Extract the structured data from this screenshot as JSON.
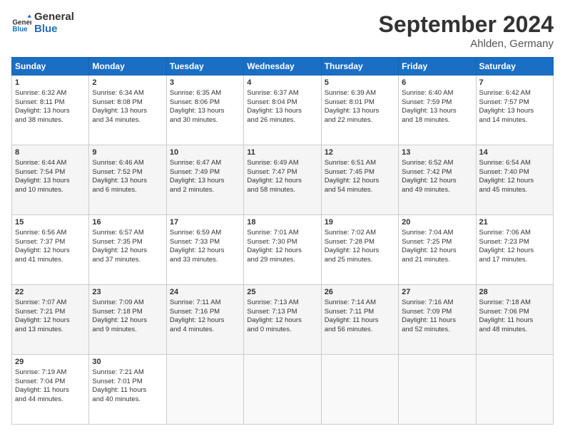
{
  "header": {
    "logo_line1": "General",
    "logo_line2": "Blue",
    "month": "September 2024",
    "location": "Ahlden, Germany"
  },
  "weekdays": [
    "Sunday",
    "Monday",
    "Tuesday",
    "Wednesday",
    "Thursday",
    "Friday",
    "Saturday"
  ],
  "weeks": [
    [
      {
        "day": "1",
        "lines": [
          "Sunrise: 6:32 AM",
          "Sunset: 8:11 PM",
          "Daylight: 13 hours",
          "and 38 minutes."
        ]
      },
      {
        "day": "2",
        "lines": [
          "Sunrise: 6:34 AM",
          "Sunset: 8:08 PM",
          "Daylight: 13 hours",
          "and 34 minutes."
        ]
      },
      {
        "day": "3",
        "lines": [
          "Sunrise: 6:35 AM",
          "Sunset: 8:06 PM",
          "Daylight: 13 hours",
          "and 30 minutes."
        ]
      },
      {
        "day": "4",
        "lines": [
          "Sunrise: 6:37 AM",
          "Sunset: 8:04 PM",
          "Daylight: 13 hours",
          "and 26 minutes."
        ]
      },
      {
        "day": "5",
        "lines": [
          "Sunrise: 6:39 AM",
          "Sunset: 8:01 PM",
          "Daylight: 13 hours",
          "and 22 minutes."
        ]
      },
      {
        "day": "6",
        "lines": [
          "Sunrise: 6:40 AM",
          "Sunset: 7:59 PM",
          "Daylight: 13 hours",
          "and 18 minutes."
        ]
      },
      {
        "day": "7",
        "lines": [
          "Sunrise: 6:42 AM",
          "Sunset: 7:57 PM",
          "Daylight: 13 hours",
          "and 14 minutes."
        ]
      }
    ],
    [
      {
        "day": "8",
        "lines": [
          "Sunrise: 6:44 AM",
          "Sunset: 7:54 PM",
          "Daylight: 13 hours",
          "and 10 minutes."
        ]
      },
      {
        "day": "9",
        "lines": [
          "Sunrise: 6:46 AM",
          "Sunset: 7:52 PM",
          "Daylight: 13 hours",
          "and 6 minutes."
        ]
      },
      {
        "day": "10",
        "lines": [
          "Sunrise: 6:47 AM",
          "Sunset: 7:49 PM",
          "Daylight: 13 hours",
          "and 2 minutes."
        ]
      },
      {
        "day": "11",
        "lines": [
          "Sunrise: 6:49 AM",
          "Sunset: 7:47 PM",
          "Daylight: 12 hours",
          "and 58 minutes."
        ]
      },
      {
        "day": "12",
        "lines": [
          "Sunrise: 6:51 AM",
          "Sunset: 7:45 PM",
          "Daylight: 12 hours",
          "and 54 minutes."
        ]
      },
      {
        "day": "13",
        "lines": [
          "Sunrise: 6:52 AM",
          "Sunset: 7:42 PM",
          "Daylight: 12 hours",
          "and 49 minutes."
        ]
      },
      {
        "day": "14",
        "lines": [
          "Sunrise: 6:54 AM",
          "Sunset: 7:40 PM",
          "Daylight: 12 hours",
          "and 45 minutes."
        ]
      }
    ],
    [
      {
        "day": "15",
        "lines": [
          "Sunrise: 6:56 AM",
          "Sunset: 7:37 PM",
          "Daylight: 12 hours",
          "and 41 minutes."
        ]
      },
      {
        "day": "16",
        "lines": [
          "Sunrise: 6:57 AM",
          "Sunset: 7:35 PM",
          "Daylight: 12 hours",
          "and 37 minutes."
        ]
      },
      {
        "day": "17",
        "lines": [
          "Sunrise: 6:59 AM",
          "Sunset: 7:33 PM",
          "Daylight: 12 hours",
          "and 33 minutes."
        ]
      },
      {
        "day": "18",
        "lines": [
          "Sunrise: 7:01 AM",
          "Sunset: 7:30 PM",
          "Daylight: 12 hours",
          "and 29 minutes."
        ]
      },
      {
        "day": "19",
        "lines": [
          "Sunrise: 7:02 AM",
          "Sunset: 7:28 PM",
          "Daylight: 12 hours",
          "and 25 minutes."
        ]
      },
      {
        "day": "20",
        "lines": [
          "Sunrise: 7:04 AM",
          "Sunset: 7:25 PM",
          "Daylight: 12 hours",
          "and 21 minutes."
        ]
      },
      {
        "day": "21",
        "lines": [
          "Sunrise: 7:06 AM",
          "Sunset: 7:23 PM",
          "Daylight: 12 hours",
          "and 17 minutes."
        ]
      }
    ],
    [
      {
        "day": "22",
        "lines": [
          "Sunrise: 7:07 AM",
          "Sunset: 7:21 PM",
          "Daylight: 12 hours",
          "and 13 minutes."
        ]
      },
      {
        "day": "23",
        "lines": [
          "Sunrise: 7:09 AM",
          "Sunset: 7:18 PM",
          "Daylight: 12 hours",
          "and 9 minutes."
        ]
      },
      {
        "day": "24",
        "lines": [
          "Sunrise: 7:11 AM",
          "Sunset: 7:16 PM",
          "Daylight: 12 hours",
          "and 4 minutes."
        ]
      },
      {
        "day": "25",
        "lines": [
          "Sunrise: 7:13 AM",
          "Sunset: 7:13 PM",
          "Daylight: 12 hours",
          "and 0 minutes."
        ]
      },
      {
        "day": "26",
        "lines": [
          "Sunrise: 7:14 AM",
          "Sunset: 7:11 PM",
          "Daylight: 11 hours",
          "and 56 minutes."
        ]
      },
      {
        "day": "27",
        "lines": [
          "Sunrise: 7:16 AM",
          "Sunset: 7:09 PM",
          "Daylight: 11 hours",
          "and 52 minutes."
        ]
      },
      {
        "day": "28",
        "lines": [
          "Sunrise: 7:18 AM",
          "Sunset: 7:06 PM",
          "Daylight: 11 hours",
          "and 48 minutes."
        ]
      }
    ],
    [
      {
        "day": "29",
        "lines": [
          "Sunrise: 7:19 AM",
          "Sunset: 7:04 PM",
          "Daylight: 11 hours",
          "and 44 minutes."
        ]
      },
      {
        "day": "30",
        "lines": [
          "Sunrise: 7:21 AM",
          "Sunset: 7:01 PM",
          "Daylight: 11 hours",
          "and 40 minutes."
        ]
      },
      {
        "day": "",
        "lines": []
      },
      {
        "day": "",
        "lines": []
      },
      {
        "day": "",
        "lines": []
      },
      {
        "day": "",
        "lines": []
      },
      {
        "day": "",
        "lines": []
      }
    ]
  ]
}
